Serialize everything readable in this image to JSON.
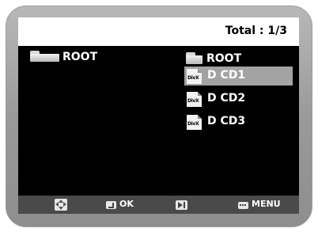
{
  "header": {
    "total_label": "Total : 1/3"
  },
  "left_panel": {
    "folder_label": "ROOT",
    "folder_icon": "folder-icon"
  },
  "right_panel": {
    "folder_label": "ROOT",
    "folder_icon": "folder-icon",
    "files": [
      {
        "icon": "divx-file-icon",
        "icon_text": "DivX",
        "label": "D CD1",
        "selected": true
      },
      {
        "icon": "divx-file-icon",
        "icon_text": "DivX",
        "label": "D CD2",
        "selected": false
      },
      {
        "icon": "divx-file-icon",
        "icon_text": "DivX",
        "label": "D CD3",
        "selected": false
      }
    ]
  },
  "footer": {
    "nav_icon": "navigation-arrows-icon",
    "ok_icon": "enter-icon",
    "ok_label": "OK",
    "play_icon": "play-skip-icon",
    "menu_icon": "menu-icon",
    "menu_label": "MENU"
  },
  "colors": {
    "frame": "#9e9e9e",
    "screen": "#000000",
    "selection": "#a3a3a3",
    "bottom_bar": "#4a4a4a",
    "text": "#ffffff"
  }
}
